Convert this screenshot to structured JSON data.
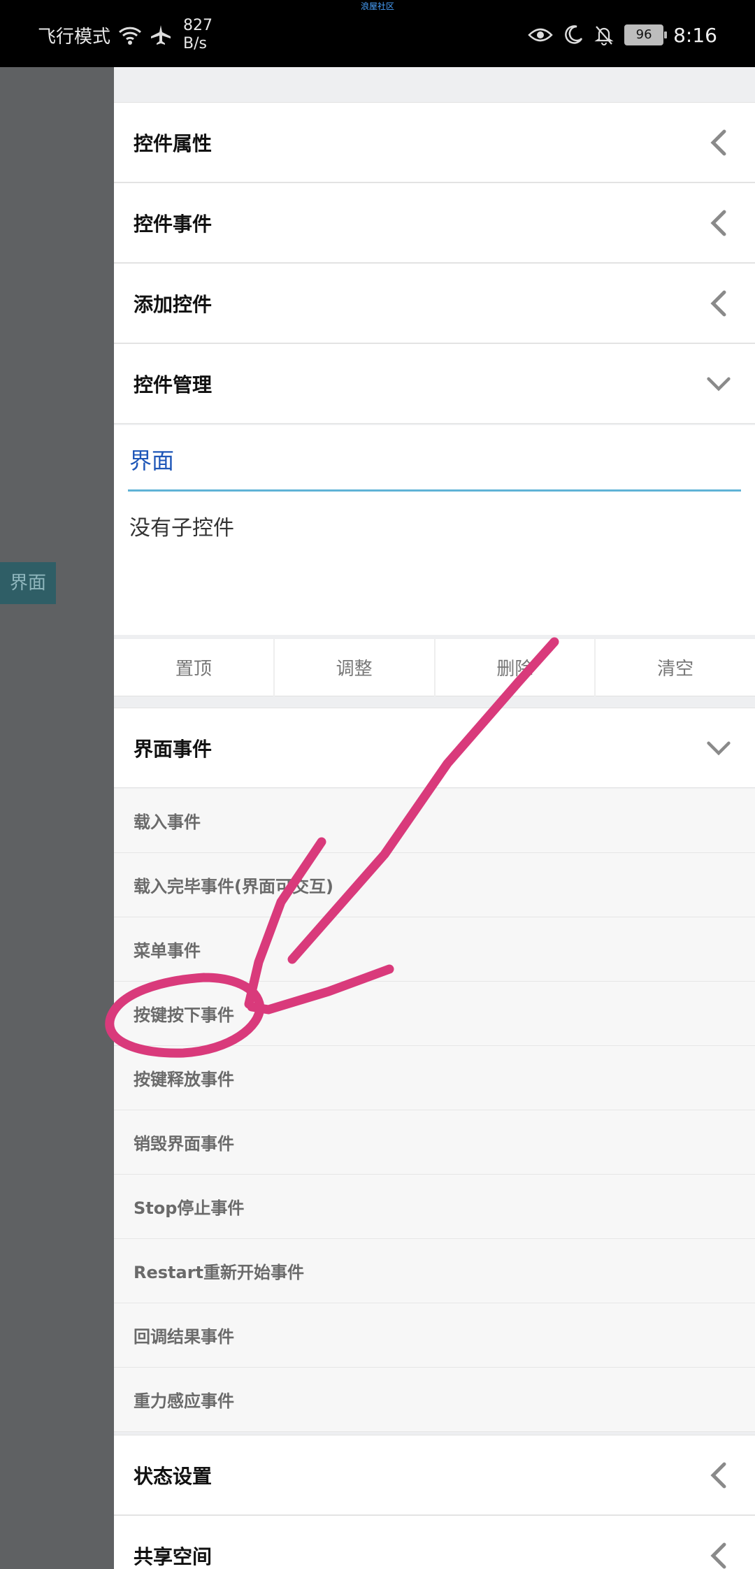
{
  "status_bar": {
    "carrier": "飞行模式",
    "net_speed_value": "827",
    "net_speed_unit": "B/s",
    "center_label": "浪屋社区",
    "battery": "96",
    "time": "8:16"
  },
  "side_tab": {
    "label": "界面"
  },
  "sections": {
    "props": "控件属性",
    "events": "控件事件",
    "add": "添加控件",
    "manage": "控件管理",
    "ui_events": "界面事件",
    "state": "状态设置",
    "share": "共享空间"
  },
  "manage_panel": {
    "title": "界面",
    "empty": "没有子控件"
  },
  "buttons": [
    "置顶",
    "调整",
    "删除",
    "清空"
  ],
  "ui_event_items": [
    "载入事件",
    "载入完毕事件(界面可交互)",
    "菜单事件",
    "按键按下事件",
    "按键释放事件",
    "销毁界面事件",
    "Stop停止事件",
    "Restart重新开始事件",
    "回调结果事件",
    "重力感应事件"
  ],
  "colors": {
    "annotation": "#d93a7b",
    "accent": "#1f57b8"
  }
}
